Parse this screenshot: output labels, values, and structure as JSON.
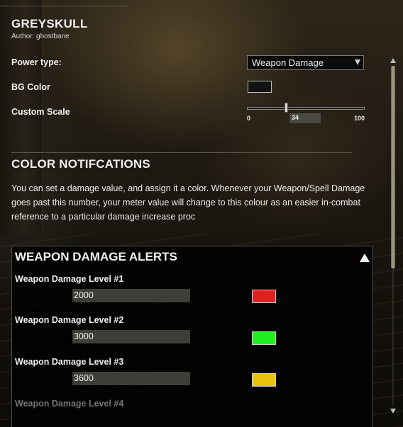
{
  "header": {
    "title": "GREYSKULL",
    "author": "Author: ghostbane"
  },
  "settings": {
    "power_type_label": "Power type:",
    "power_type_value": "Weapon Damage",
    "bg_color_label": "BG Color",
    "bg_color_value": "#111111",
    "custom_scale_label": "Custom Scale",
    "scale_min": "0",
    "scale_max": "100",
    "scale_value": "34",
    "scale_fraction": 0.34
  },
  "notifications": {
    "title": "COLOR NOTIFCATIONS",
    "description": "You can set a damage value, and assign it a color. Whenever your Weapon/Spell Damage goes past this number, your meter value will change to this colour as an easier in-combat reference to a particular damage increase proc"
  },
  "alerts": {
    "title": "WEAPON DAMAGE ALERTS",
    "levels": [
      {
        "label": "Weapon Damage Level #1",
        "value": "2000",
        "color": "#e02020"
      },
      {
        "label": "Weapon Damage Level #2",
        "value": "3000",
        "color": "#22ee22"
      },
      {
        "label": "Weapon Damage Level #3",
        "value": "3600",
        "color": "#e8c410"
      },
      {
        "label": "Weapon Damage Level #4"
      }
    ]
  }
}
